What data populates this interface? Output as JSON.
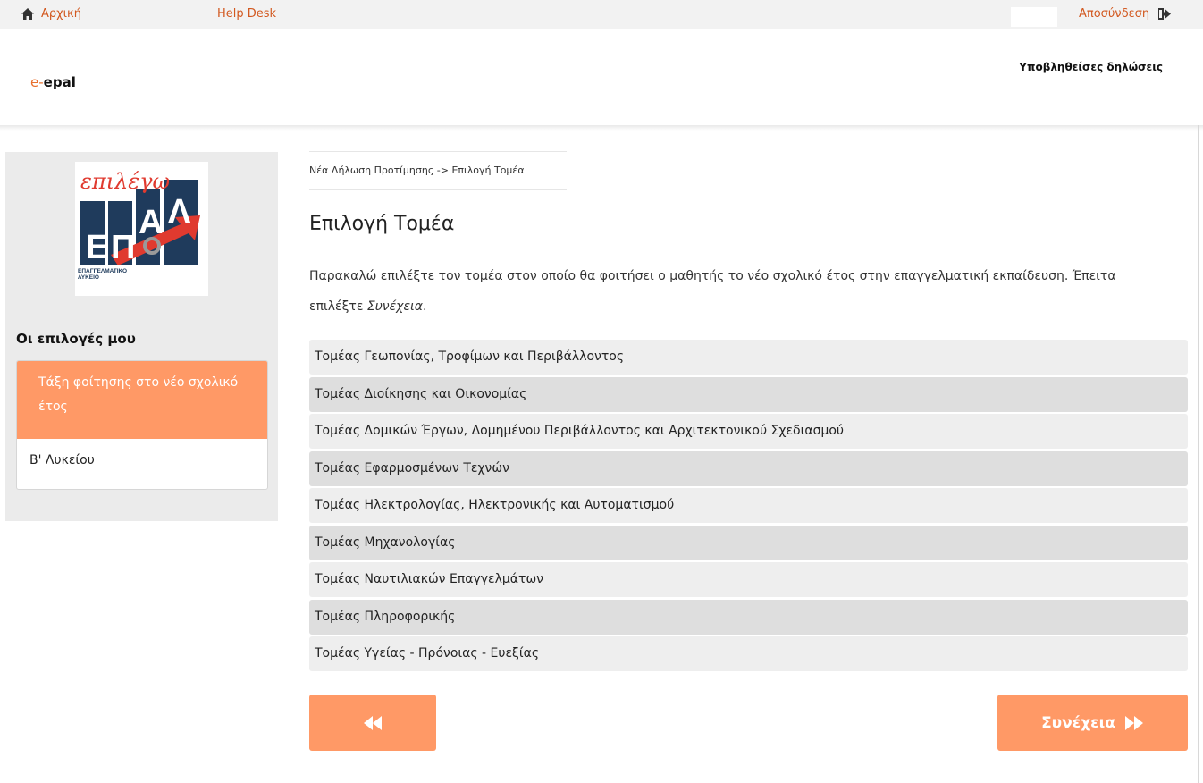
{
  "topbar": {
    "home_label": "Αρχική",
    "helpdesk_label": "Help Desk",
    "logout_label": "Αποσύνδεση"
  },
  "header": {
    "brand_prefix": "e-",
    "brand_name": "epal",
    "submitted_link": "Υποβληθείσες δηλώσεις"
  },
  "sidebar": {
    "logo": {
      "script_text": "επιλέγω",
      "letters": "ΕΠΑΛ",
      "caption_line1": "ΕΠΑΓΓΕΛΜΑΤΙΚΟ",
      "caption_line2": "ΛΥΚΕΙΟ"
    },
    "heading": "Οι επιλογές μου",
    "card_title": "Τάξη φοίτησης στο νέο σχολικό έτος",
    "card_value": "Β' Λυκείου"
  },
  "main": {
    "breadcrumb": "Νέα Δήλωση Προτίμησης -> Επιλογή Τομέα",
    "title": "Επιλογή Τομέα",
    "description_main": "Παρακαλώ επιλέξτε τον τομέα στον οποίο θα φοιτήσει ο μαθητής το νέο σχολικό έτος στην επαγγελματική εκπαίδευση. Έπειτα επιλέξτε ",
    "description_em": "Συνέχεια",
    "description_end": ".",
    "sectors": [
      "Τομέας Γεωπονίας, Τροφίμων και Περιβάλλοντος",
      "Τομέας Διοίκησης και Οικονομίας",
      "Τομέας Δομικών Έργων, Δομημένου Περιβάλλοντος και Αρχιτεκτονικού Σχεδιασμού",
      "Τομέας Εφαρμοσμένων Τεχνών",
      "Τομέας Ηλεκτρολογίας, Ηλεκτρονικής και Αυτοματισμού",
      "Τομέας Μηχανολογίας",
      "Τομέας Ναυτιλιακών Επαγγελμάτων",
      "Τομέας Πληροφορικής",
      "Τομέας Υγείας - Πρόνοιας - Ευεξίας"
    ],
    "next_label": "Συνέχεια"
  },
  "colors": {
    "accent": "#ff9966",
    "link": "#d2581f",
    "logo_blue": "#1f3b5c",
    "logo_red": "#e03a2f"
  },
  "icons": {
    "home": "home-icon",
    "logout": "logout-icon",
    "back": "fast-backward-icon",
    "next": "fast-forward-icon"
  }
}
